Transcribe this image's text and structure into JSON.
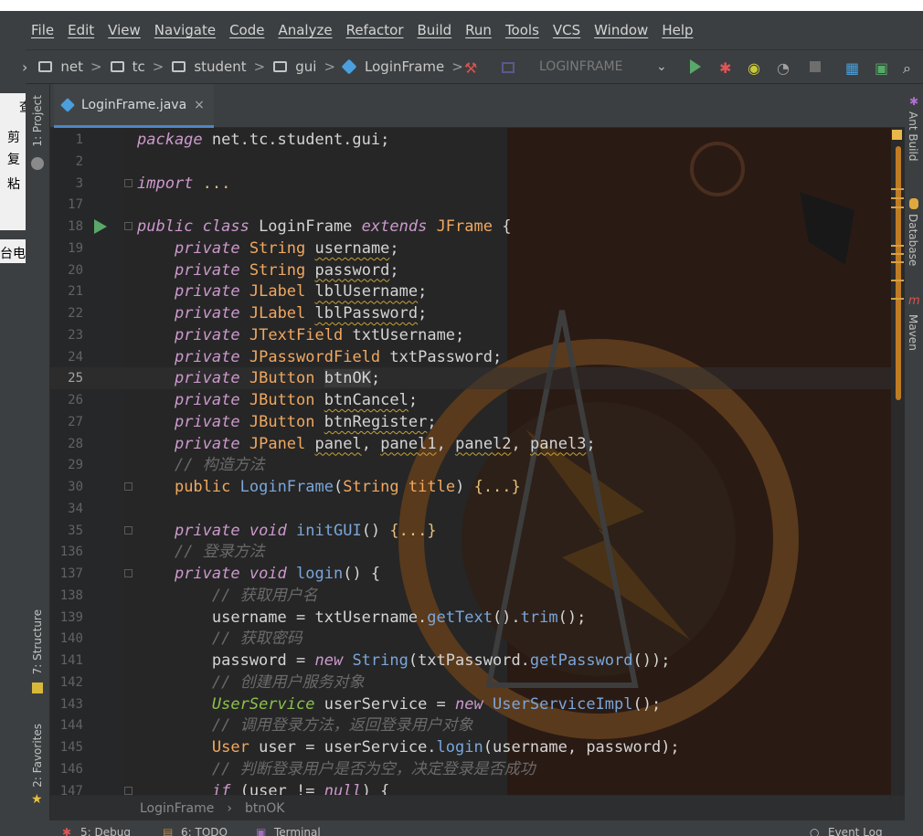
{
  "menu": [
    "File",
    "Edit",
    "View",
    "Navigate",
    "Code",
    "Analyze",
    "Refactor",
    "Build",
    "Run",
    "Tools",
    "VCS",
    "Window",
    "Help"
  ],
  "navbar": {
    "crumbs": [
      "net",
      "tc",
      "student",
      "gui"
    ],
    "class_crumb": "LoginFrame",
    "run_config": "LOGINFRAME"
  },
  "behind_window": {
    "items": [
      "查",
      "剪",
      "复",
      "粘",
      "台电"
    ]
  },
  "left_tools": {
    "project": "1: Project",
    "structure": "7: Structure",
    "favorites": "2: Favorites"
  },
  "right_tools": {
    "ant": "Ant Build",
    "database": "Database",
    "maven": "Maven"
  },
  "tab": {
    "filename": "LoginFrame.java",
    "close": "×"
  },
  "breadcrumb": {
    "class_name": "LoginFrame",
    "member": "btnOK",
    "separator": "›"
  },
  "bottom": {
    "debug": "5: Debug",
    "todo": "6: TODO",
    "terminal": "Terminal",
    "event_log": "Event Log"
  },
  "code_lines": [
    {
      "n": "1",
      "segments": [
        [
          "kw",
          "package"
        ],
        [
          "pl",
          " net.tc.student.gui;"
        ]
      ]
    },
    {
      "n": "2",
      "segments": []
    },
    {
      "n": "3",
      "segments": [
        [
          "kw",
          "import"
        ],
        [
          "pl",
          " "
        ],
        [
          "pb",
          "..."
        ]
      ]
    },
    {
      "n": "17",
      "segments": []
    },
    {
      "n": "18",
      "segments": [
        [
          "kw",
          "public class"
        ],
        [
          "pl",
          " LoginFrame "
        ],
        [
          "kw",
          "extends"
        ],
        [
          "pl",
          " "
        ],
        [
          "ty",
          "JFrame"
        ],
        [
          "pl",
          " {"
        ]
      ]
    },
    {
      "n": "19",
      "segments": [
        [
          "pl",
          "    "
        ],
        [
          "kw",
          "private"
        ],
        [
          "pl",
          " "
        ],
        [
          "ty",
          "String"
        ],
        [
          "pl",
          " "
        ],
        [
          "sq",
          "username"
        ],
        [
          "pl",
          ";"
        ]
      ]
    },
    {
      "n": "20",
      "segments": [
        [
          "pl",
          "    "
        ],
        [
          "kw",
          "private"
        ],
        [
          "pl",
          " "
        ],
        [
          "ty",
          "String"
        ],
        [
          "pl",
          " "
        ],
        [
          "sq",
          "password"
        ],
        [
          "pl",
          ";"
        ]
      ]
    },
    {
      "n": "21",
      "segments": [
        [
          "pl",
          "    "
        ],
        [
          "kw",
          "private"
        ],
        [
          "pl",
          " "
        ],
        [
          "ty",
          "JLabel"
        ],
        [
          "pl",
          " "
        ],
        [
          "sq",
          "lblUsername"
        ],
        [
          "pl",
          ";"
        ]
      ]
    },
    {
      "n": "22",
      "segments": [
        [
          "pl",
          "    "
        ],
        [
          "kw",
          "private"
        ],
        [
          "pl",
          " "
        ],
        [
          "ty",
          "JLabel"
        ],
        [
          "pl",
          " "
        ],
        [
          "sq",
          "lblPassword"
        ],
        [
          "pl",
          ";"
        ]
      ]
    },
    {
      "n": "23",
      "segments": [
        [
          "pl",
          "    "
        ],
        [
          "kw",
          "private"
        ],
        [
          "pl",
          " "
        ],
        [
          "ty",
          "JTextField"
        ],
        [
          "pl",
          " txtUsername;"
        ]
      ]
    },
    {
      "n": "24",
      "segments": [
        [
          "pl",
          "    "
        ],
        [
          "kw",
          "private"
        ],
        [
          "pl",
          " "
        ],
        [
          "ty",
          "JPasswordField"
        ],
        [
          "pl",
          " txtPassword;"
        ]
      ]
    },
    {
      "n": "25",
      "current": true,
      "segments": [
        [
          "pl",
          "    "
        ],
        [
          "kw",
          "private"
        ],
        [
          "pl",
          " "
        ],
        [
          "ty",
          "JButton"
        ],
        [
          "pl",
          " "
        ],
        [
          "hl",
          "btnOK"
        ],
        [
          "pl",
          ";"
        ]
      ]
    },
    {
      "n": "26",
      "segments": [
        [
          "pl",
          "    "
        ],
        [
          "kw",
          "private"
        ],
        [
          "pl",
          " "
        ],
        [
          "ty",
          "JButton"
        ],
        [
          "pl",
          " "
        ],
        [
          "sq",
          "btnCancel"
        ],
        [
          "pl",
          ";"
        ]
      ]
    },
    {
      "n": "27",
      "segments": [
        [
          "pl",
          "    "
        ],
        [
          "kw",
          "private"
        ],
        [
          "pl",
          " "
        ],
        [
          "ty",
          "JButton"
        ],
        [
          "pl",
          " "
        ],
        [
          "sq",
          "btnRegister"
        ],
        [
          "pl",
          ";"
        ]
      ]
    },
    {
      "n": "28",
      "segments": [
        [
          "pl",
          "    "
        ],
        [
          "kw",
          "private"
        ],
        [
          "pl",
          " "
        ],
        [
          "ty",
          "JPanel"
        ],
        [
          "pl",
          " "
        ],
        [
          "sq",
          "panel"
        ],
        [
          "pl",
          ", "
        ],
        [
          "sq",
          "panel1"
        ],
        [
          "pl",
          ", "
        ],
        [
          "sq",
          "panel2"
        ],
        [
          "pl",
          ", "
        ],
        [
          "sq",
          "panel3"
        ],
        [
          "pl",
          ";"
        ]
      ]
    },
    {
      "n": "29",
      "segments": [
        [
          "pl",
          "    "
        ],
        [
          "cm",
          "// 构造方法"
        ]
      ]
    },
    {
      "n": "30",
      "segments": [
        [
          "pl",
          "    "
        ],
        [
          "ty",
          "public"
        ],
        [
          "pl",
          " "
        ],
        [
          "fn",
          "LoginFrame"
        ],
        [
          "pl",
          "("
        ],
        [
          "ty",
          "String"
        ],
        [
          "pl",
          " "
        ],
        [
          "ty",
          "title"
        ],
        [
          "pl",
          ") "
        ],
        [
          "pb",
          "{...}"
        ]
      ]
    },
    {
      "n": "34",
      "segments": []
    },
    {
      "n": "35",
      "segments": [
        [
          "pl",
          "    "
        ],
        [
          "kw",
          "private void"
        ],
        [
          "pl",
          " "
        ],
        [
          "fn",
          "initGUI"
        ],
        [
          "pl",
          "() "
        ],
        [
          "pb",
          "{...}"
        ]
      ]
    },
    {
      "n": "136",
      "segments": [
        [
          "pl",
          "    "
        ],
        [
          "cm",
          "// 登录方法"
        ]
      ]
    },
    {
      "n": "137",
      "segments": [
        [
          "pl",
          "    "
        ],
        [
          "kw",
          "private void"
        ],
        [
          "pl",
          " "
        ],
        [
          "fn",
          "login"
        ],
        [
          "pl",
          "() {"
        ]
      ]
    },
    {
      "n": "138",
      "segments": [
        [
          "pl",
          "        "
        ],
        [
          "cm",
          "// 获取用户名"
        ]
      ]
    },
    {
      "n": "139",
      "segments": [
        [
          "pl",
          "        username = txtUsername."
        ],
        [
          "fn",
          "getText"
        ],
        [
          "pl",
          "()."
        ],
        [
          "fn",
          "trim"
        ],
        [
          "pl",
          "();"
        ]
      ]
    },
    {
      "n": "140",
      "segments": [
        [
          "pl",
          "        "
        ],
        [
          "cm",
          "// 获取密码"
        ]
      ]
    },
    {
      "n": "141",
      "segments": [
        [
          "pl",
          "        password = "
        ],
        [
          "kw",
          "new"
        ],
        [
          "pl",
          " "
        ],
        [
          "fn",
          "String"
        ],
        [
          "pl",
          "(txtPassword."
        ],
        [
          "fn",
          "getPassword"
        ],
        [
          "pl",
          "());"
        ]
      ]
    },
    {
      "n": "142",
      "segments": [
        [
          "pl",
          "        "
        ],
        [
          "cm",
          "// 创建用户服务对象"
        ]
      ]
    },
    {
      "n": "143",
      "segments": [
        [
          "pl",
          "        "
        ],
        [
          "gn",
          "UserService"
        ],
        [
          "pl",
          " userService = "
        ],
        [
          "kw",
          "new"
        ],
        [
          "pl",
          " "
        ],
        [
          "fn",
          "UserServiceImpl"
        ],
        [
          "pl",
          "();"
        ]
      ]
    },
    {
      "n": "144",
      "segments": [
        [
          "pl",
          "        "
        ],
        [
          "cm",
          "// 调用登录方法，返回登录用户对象"
        ]
      ]
    },
    {
      "n": "145",
      "segments": [
        [
          "pl",
          "        "
        ],
        [
          "ty",
          "User"
        ],
        [
          "pl",
          " user = userService."
        ],
        [
          "fn",
          "login"
        ],
        [
          "pl",
          "(username, password);"
        ]
      ]
    },
    {
      "n": "146",
      "segments": [
        [
          "pl",
          "        "
        ],
        [
          "cm",
          "// 判断登录用户是否为空，决定登录是否成功"
        ]
      ]
    },
    {
      "n": "147",
      "segments": [
        [
          "pl",
          "        "
        ],
        [
          "kw",
          "if"
        ],
        [
          "pl",
          " (user != "
        ],
        [
          "kw",
          "null"
        ],
        [
          "pl",
          ") {"
        ]
      ]
    }
  ],
  "colors": {
    "keyword": "#cc99cd",
    "type": "#f0a860",
    "function": "#7aa6da",
    "comment": "#6a6a6a",
    "run_green": "#59a869",
    "scroll_marker": "#d6a142"
  }
}
